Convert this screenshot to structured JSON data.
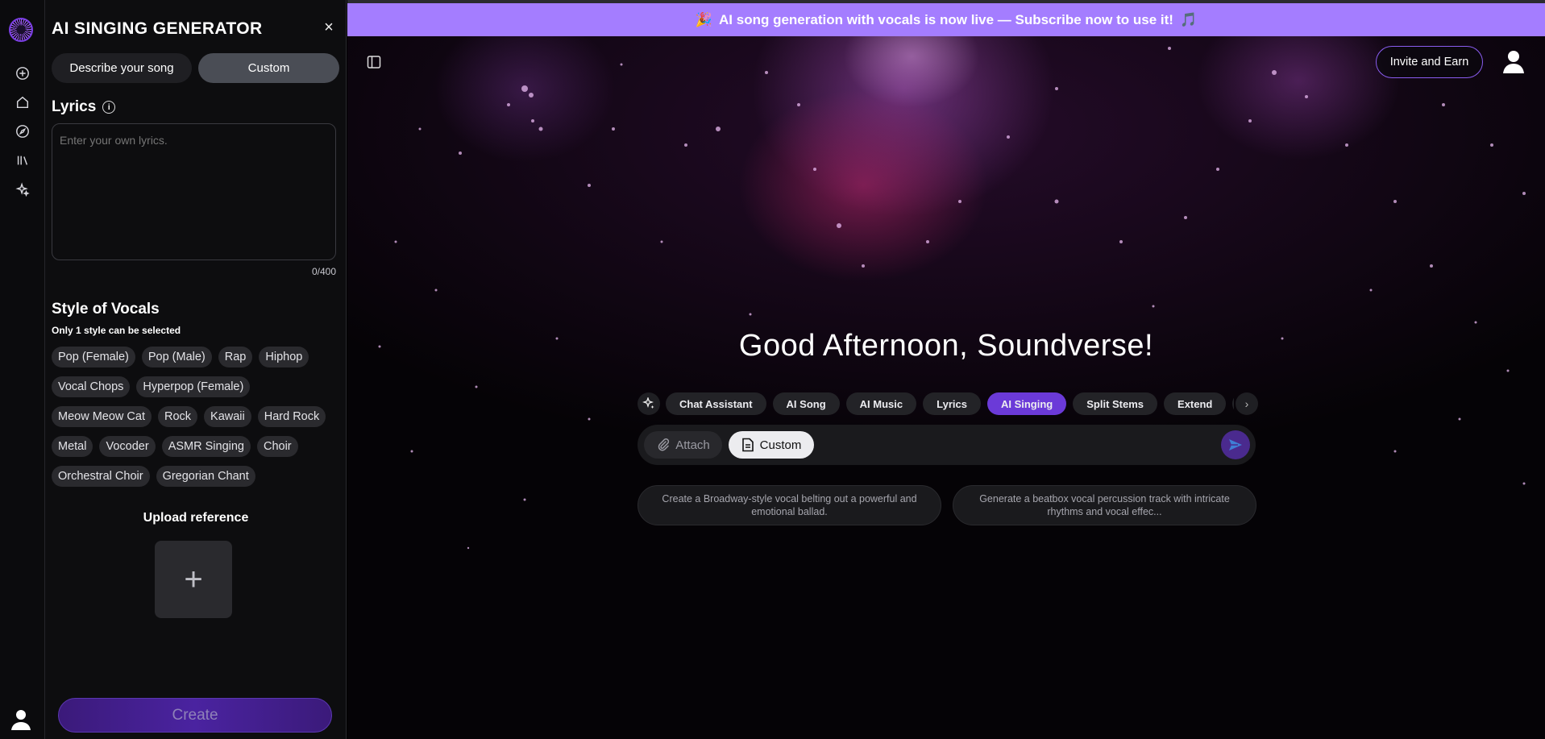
{
  "banner": {
    "text": "AI song generation with vocals is now live — Subscribe now to use it!"
  },
  "panel": {
    "title": "AI SINGING GENERATOR",
    "close": "×",
    "mode_describe": "Describe your song",
    "mode_custom": "Custom",
    "lyrics_label": "Lyrics",
    "lyrics_placeholder": "Enter your own lyrics.",
    "char_count": "0/400",
    "vocals_title": "Style of Vocals",
    "vocals_sub": "Only 1 style can be selected",
    "vocal_styles": [
      "Pop (Female)",
      "Pop (Male)",
      "Rap",
      "Hiphop",
      "Vocal Chops",
      "Hyperpop (Female)",
      "Meow Meow Cat",
      "Rock",
      "Kawaii",
      "Hard Rock",
      "Metal",
      "Vocoder",
      "ASMR Singing",
      "Choir",
      "Orchestral Choir",
      "Gregorian Chant"
    ],
    "upload_label": "Upload reference",
    "upload_plus": "+",
    "create_label": "Create"
  },
  "header": {
    "invite_label": "Invite and Earn"
  },
  "main": {
    "greeting": "Good Afternoon, Soundverse!",
    "tools": [
      "Chat Assistant",
      "AI Song",
      "AI Music",
      "Lyrics",
      "AI Singing",
      "Split Stems",
      "Extend",
      "Re"
    ],
    "active_tool": "AI Singing",
    "attach_label": "Attach",
    "custom_label": "Custom",
    "suggestions": [
      "Create a Broadway-style vocal belting out a powerful and emotional ballad.",
      "Generate a beatbox vocal percussion track with intricate rhythms and vocal effec..."
    ]
  },
  "colors": {
    "accent": "#6b3ad8",
    "banner": "#a47dff",
    "panel_bg": "#0d0d0f"
  }
}
